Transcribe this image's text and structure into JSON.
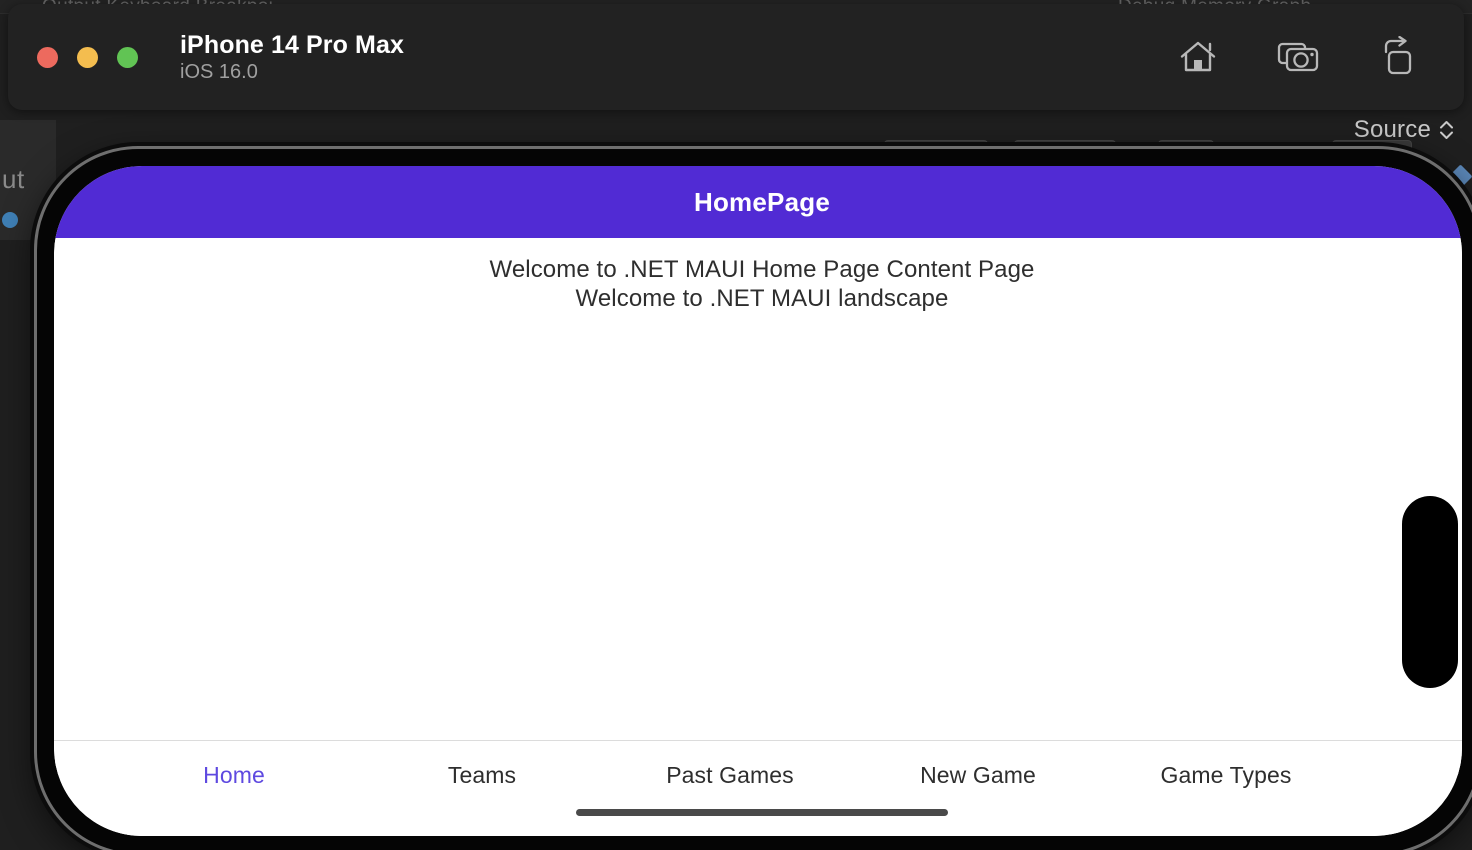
{
  "background": {
    "ghost_text_left": "Output  Keyboard  Breakpoi",
    "ghost_text_right": "Debug   Memory Graph",
    "sidebar_word": "ut",
    "source_label": "Source",
    "chevron_up": "⌃",
    "chevron_down": "⌄"
  },
  "simulator": {
    "device_name": "iPhone 14 Pro Max",
    "os_version": "iOS 16.0",
    "traffic_lights": [
      {
        "name": "close",
        "color": "#ed6a5e"
      },
      {
        "name": "minimize",
        "color": "#f4bd4f"
      },
      {
        "name": "zoom",
        "color": "#61c454"
      }
    ],
    "actions": [
      {
        "icon": "home-icon",
        "label": "Home"
      },
      {
        "icon": "screenshot-camera-icon",
        "label": "Screenshot"
      },
      {
        "icon": "rotate-icon",
        "label": "Rotate"
      }
    ]
  },
  "app": {
    "navbar": {
      "title": "HomePage",
      "background": "#512BD4",
      "text_color": "#FFFFFF"
    },
    "content": {
      "lines": [
        "Welcome to .NET MAUI Home Page Content Page",
        "Welcome to .NET MAUI landscape"
      ],
      "text_color": "#2E2E2E",
      "background": "#FFFFFF"
    },
    "tabbar": {
      "active_color": "#5E49E0",
      "inactive_color": "#2E2E2E",
      "tabs": [
        {
          "label": "Home",
          "active": true
        },
        {
          "label": "Teams",
          "active": false
        },
        {
          "label": "Past Games",
          "active": false
        },
        {
          "label": "New Game",
          "active": false
        },
        {
          "label": "Game Types",
          "active": false
        }
      ]
    }
  }
}
